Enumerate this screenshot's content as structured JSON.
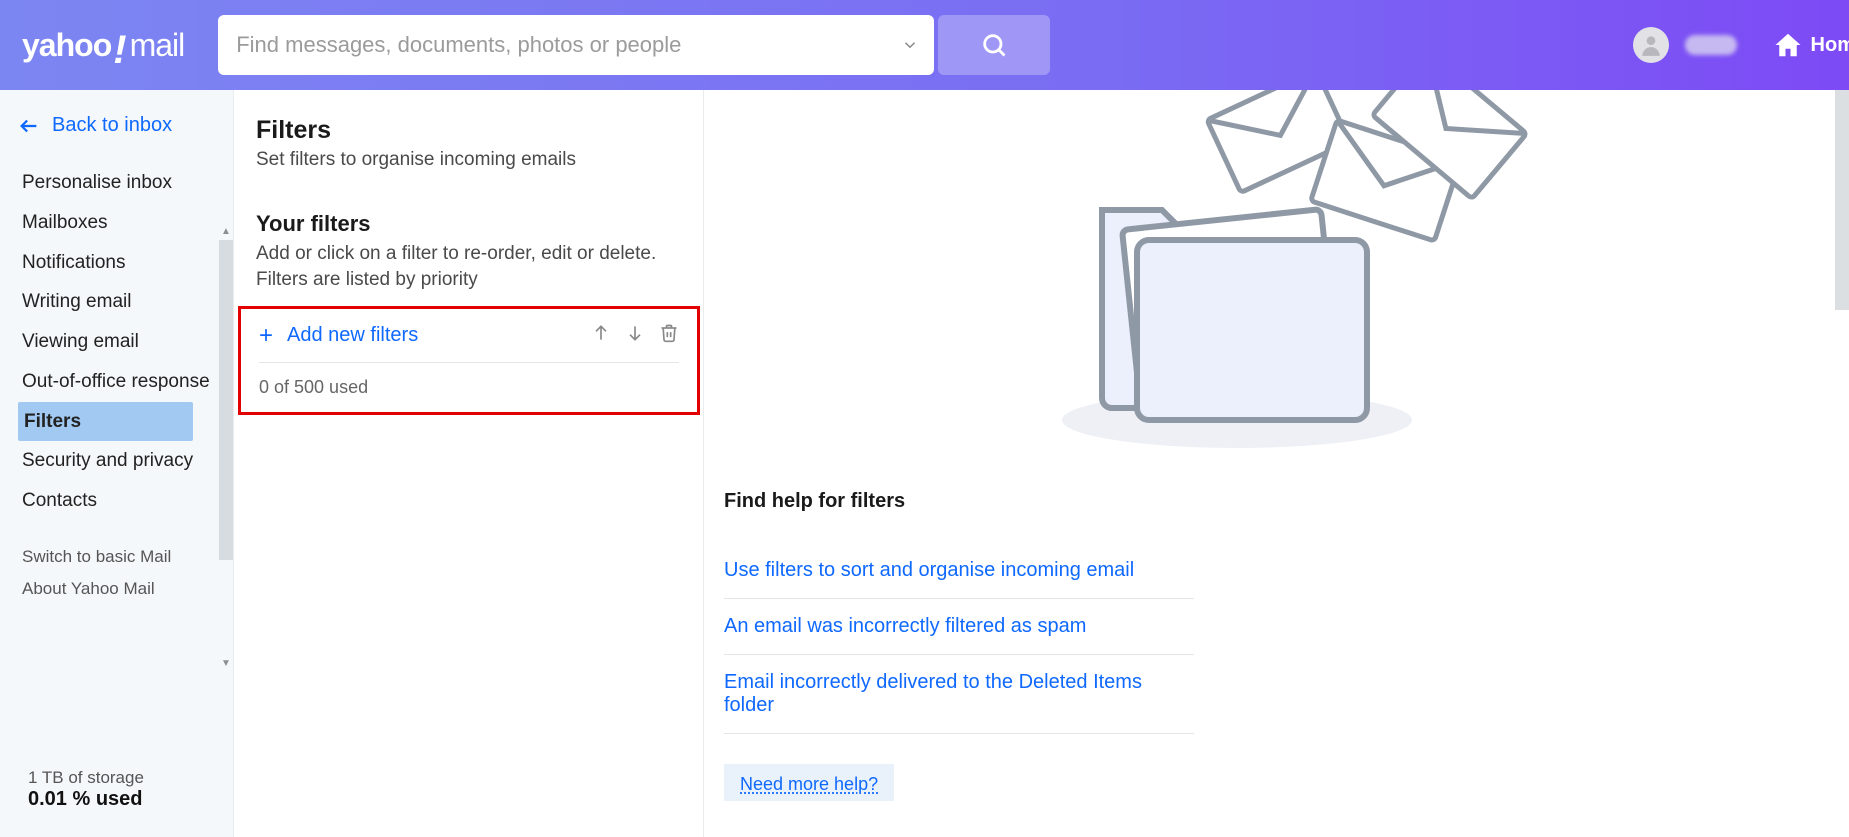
{
  "header": {
    "logo_text_a": "yahoo",
    "logo_text_b": "mail",
    "search_placeholder": "Find messages, documents, photos or people",
    "home_label": "Hom"
  },
  "sidebar": {
    "back_label": "Back to inbox",
    "items": [
      "Personalise inbox",
      "Mailboxes",
      "Notifications",
      "Writing email",
      "Viewing email",
      "Out-of-office response",
      "Filters",
      "Security and privacy",
      "Contacts"
    ],
    "active_index": 6,
    "secondary": [
      "Switch to basic Mail",
      "About Yahoo Mail"
    ],
    "storage_line1": "1 TB of storage",
    "storage_line2": "0.01 % used"
  },
  "mid": {
    "title": "Filters",
    "subtitle": "Set filters to organise incoming emails",
    "section_title": "Your filters",
    "section_sub": "Add or click on a filter to re-order, edit or delete. Filters are listed by priority",
    "add_label": "Add new filters",
    "used_label": "0 of 500 used"
  },
  "right": {
    "help_title": "Find help for filters",
    "links": [
      "Use filters to sort and organise incoming email",
      "An email was incorrectly filtered as spam",
      "Email incorrectly delivered to the Deleted Items folder"
    ],
    "more_help": "Need more help?"
  }
}
